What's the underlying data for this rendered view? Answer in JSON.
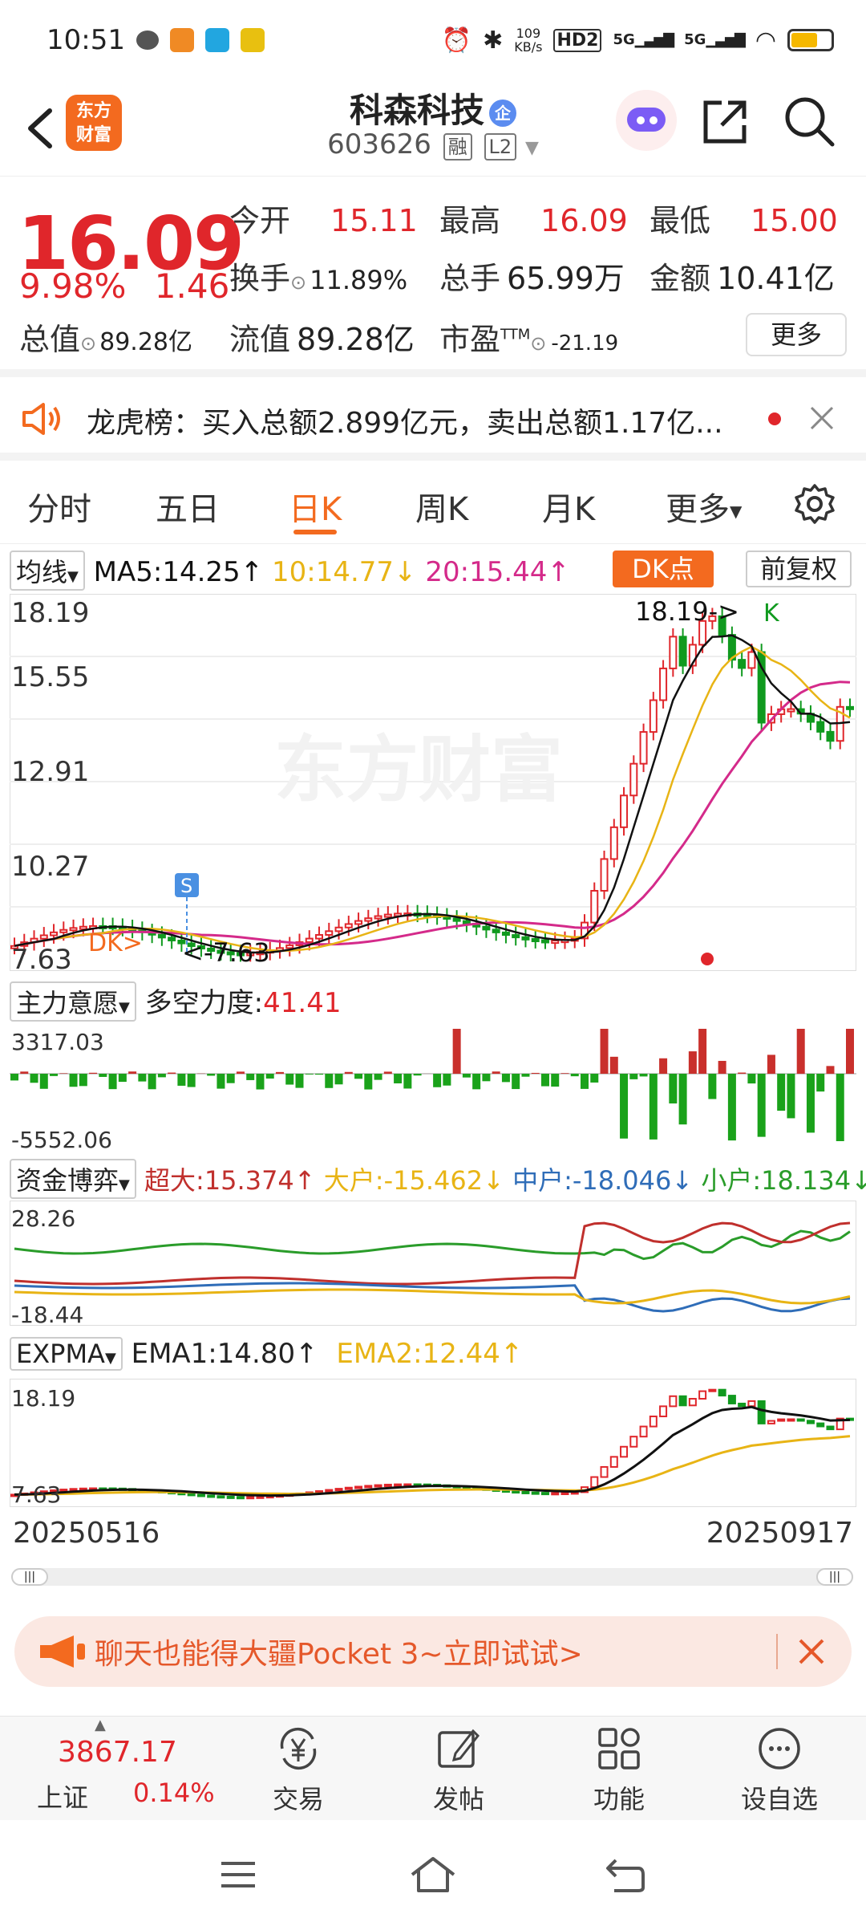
{
  "status_bar": {
    "time": "10:51",
    "net_speed": "109\nKB/s",
    "hd_label": "HD2",
    "sig1": "5G",
    "sig2": "5G"
  },
  "header": {
    "logo_text": "东方\n财富",
    "stock_name": "科森科技",
    "name_tag": "企",
    "stock_code": "603626",
    "margin_tag": "融",
    "level_tag": "L2"
  },
  "quote": {
    "price": "16.09",
    "change_pct": "9.98%",
    "change_amt": "1.46",
    "open_label": "今开",
    "open": "15.11",
    "high_label": "最高",
    "high": "16.09",
    "low_label": "最低",
    "low": "15.00",
    "turnover_label": "换手",
    "turnover": "11.89%",
    "volume_label": "总手",
    "volume": "65.99万",
    "amount_label": "金额",
    "amount": "10.41亿",
    "mktcap_label": "总值",
    "mktcap": "89.28亿",
    "float_label": "流值",
    "float": "89.28亿",
    "pe_label": "市盈",
    "pe_sup": "TTM",
    "pe": "-21.19",
    "more_label": "更多"
  },
  "notice": {
    "text": "龙虎榜：买入总额2.899亿元，卖出总额1.17亿..."
  },
  "tabs": [
    {
      "label": "分时"
    },
    {
      "label": "五日"
    },
    {
      "label": "日K"
    },
    {
      "label": "周K"
    },
    {
      "label": "月K"
    },
    {
      "label": "更多"
    }
  ],
  "kline": {
    "ma_selector": "均线",
    "ma5": "MA5:14.25↑",
    "ma10": "10:14.77↓",
    "ma20": "20:15.44↑",
    "dk_button": "DK点",
    "adjust_button": "前复权",
    "axis_labels": [
      "18.19",
      "15.55",
      "12.91",
      "10.27",
      "7.63"
    ],
    "high_marker": "18.19->",
    "low_marker": "<-7.63",
    "k_tag": "K",
    "s_tag": "S",
    "dk_tag": "DK>",
    "watermark": "东方财富",
    "colors": {
      "up": "#e0262b",
      "down": "#109a1f",
      "ma5": "#111111",
      "ma10": "#e8b415",
      "ma20": "#d42a8a"
    }
  },
  "main_force": {
    "selector": "主力意愿",
    "label": "多空力度:",
    "value": "41.41",
    "max": "3317.03",
    "min": "-5552.06"
  },
  "fund_game": {
    "selector": "资金博弈",
    "super": "超大:15.374↑",
    "large": "大户:-15.462↓",
    "medium": "中户:-18.046↓",
    "small": "小户:18.134↓",
    "max": "28.26",
    "min": "-18.44",
    "colors": {
      "super": "#c0302d",
      "large": "#e8b415",
      "medium": "#2f6db8",
      "small": "#2a9c2a"
    }
  },
  "expma": {
    "selector": "EXPMA",
    "ema1": "EMA1:14.80↑",
    "ema2": "EMA2:12.44↑",
    "max": "18.19",
    "min": "7.63"
  },
  "date_range": {
    "start": "20250516",
    "end": "20250917"
  },
  "promo": {
    "text": "聊天也能得大疆Pocket 3~立即试试>"
  },
  "bottom": {
    "index_value": "3867.17",
    "index_name": "上证",
    "index_change": "0.14%",
    "trade": "交易",
    "post": "发帖",
    "functions": "功能",
    "watchlist": "设自选"
  }
}
